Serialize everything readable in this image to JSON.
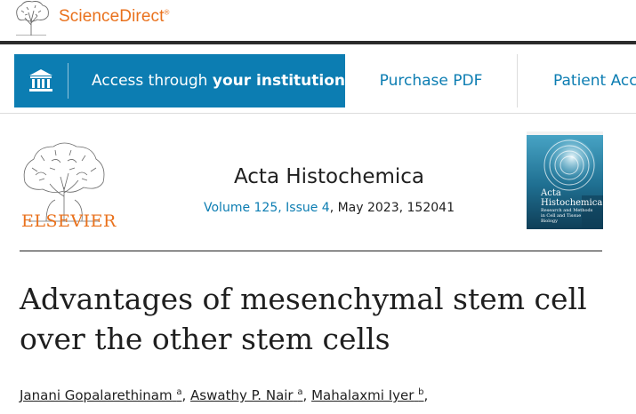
{
  "site": {
    "brand": "ScienceDirect",
    "brand_mark": "®"
  },
  "toolbar": {
    "access_prefix": "Access through ",
    "access_bold": "your institution",
    "purchase_label": "Purchase PDF",
    "patient_label": "Patient Access"
  },
  "journal": {
    "publisher_logo_text": "ELSEVIER",
    "title": "Acta Histochemica",
    "volume_issue": "Volume 125, Issue 4",
    "date_article": ", May 2023, 152041",
    "cover_title_1": "Acta",
    "cover_title_2": "Histochemica",
    "cover_subtitle": "Research and Methods in Cell and Tissue Biology"
  },
  "article": {
    "title": "Advantages of mesenchymal stem cell over the other stem cells"
  },
  "authors": [
    {
      "name": "Janani Gopalarethinam",
      "aff": "a"
    },
    {
      "name": "Aswathy P. Nair",
      "aff": "a"
    },
    {
      "name": "Mahalaxmi Iyer",
      "aff": "b"
    }
  ],
  "colors": {
    "brand_orange": "#e9711c",
    "link_blue": "#0c7db2",
    "access_bg": "#0c7db2"
  }
}
